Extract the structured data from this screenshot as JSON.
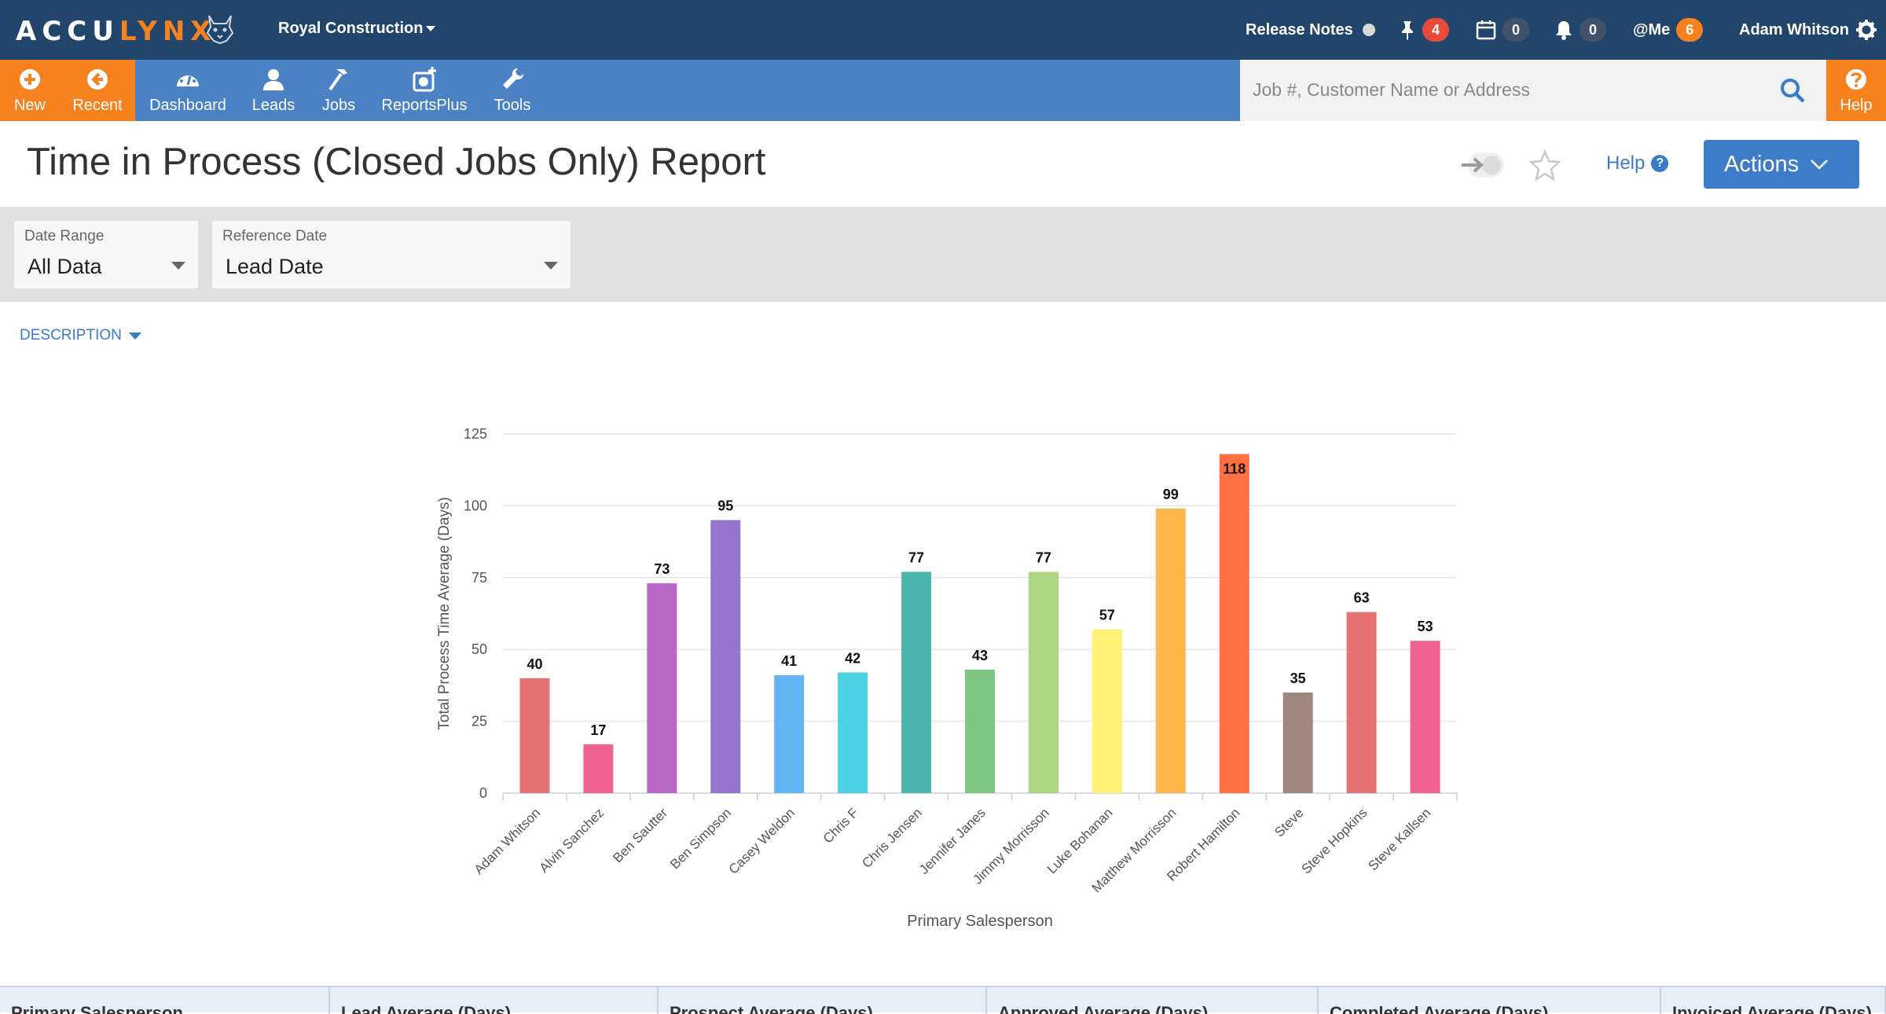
{
  "app": {
    "logo_white": "ACCU",
    "logo_orange": "LYNX",
    "company": "Royal Construction",
    "release_notes": "Release Notes",
    "pins_count": "4",
    "calendar_count": "0",
    "bell_count": "0",
    "me_label": "@Me",
    "me_count": "6",
    "user_name": "Adam Whitson"
  },
  "nav": {
    "items": [
      {
        "label": "New",
        "icon": "plus-circle-icon"
      },
      {
        "label": "Recent",
        "icon": "arrow-left-circle-icon"
      },
      {
        "label": "Dashboard",
        "icon": "dashboard-gauge-icon"
      },
      {
        "label": "Leads",
        "icon": "user-icon"
      },
      {
        "label": "Jobs",
        "icon": "hammer-icon"
      },
      {
        "label": "ReportsPlus",
        "icon": "reports-plus-icon"
      },
      {
        "label": "Tools",
        "icon": "wrench-icon"
      }
    ],
    "search_placeholder": "Job #, Customer Name or Address",
    "help_label": "Help"
  },
  "page": {
    "title": "Time in Process (Closed Jobs Only) Report",
    "help_label": "Help",
    "actions_label": "Actions",
    "description_label": "DESCRIPTION"
  },
  "filters": {
    "date_range": {
      "label": "Date Range",
      "value": "All Data"
    },
    "reference_date": {
      "label": "Reference Date",
      "value": "Lead Date"
    }
  },
  "chart_data": {
    "type": "bar",
    "xlabel": "Primary Salesperson",
    "ylabel": "Total Process Time Average (Days)",
    "ylim": [
      0,
      125
    ],
    "yticks": [
      0,
      25,
      50,
      75,
      100,
      125
    ],
    "grid": true,
    "categories": [
      "Adam Whitson",
      "Alvin Sanchez",
      "Ben Sautter",
      "Ben Simpson",
      "Casey Weldon",
      "Chris F",
      "Chris Jensen",
      "Jennifer Janes",
      "Jimmy Morrisson",
      "Luke Bohanan",
      "Matthew Morrisson",
      "Robert Hamilton",
      "Steve",
      "Steve Hopkins",
      "Steve Kallsen"
    ],
    "values": [
      40,
      17,
      73,
      95,
      41,
      42,
      77,
      43,
      77,
      57,
      99,
      118,
      35,
      63,
      53
    ],
    "colors": [
      "#e57373",
      "#f06292",
      "#ba68c8",
      "#9575cd",
      "#64b5f6",
      "#4dd0e1",
      "#4db6ac",
      "#81c784",
      "#aed581",
      "#fff176",
      "#ffb74d",
      "#ff7043",
      "#a1887f",
      "#e57373",
      "#f06292"
    ]
  },
  "table": {
    "columns": [
      "Primary Salesperson",
      "Lead Average (Days)",
      "Prospect Average (Days)",
      "Approved Average (Days)",
      "Completed Average (Days)",
      "Invoiced Average (Days)"
    ]
  }
}
